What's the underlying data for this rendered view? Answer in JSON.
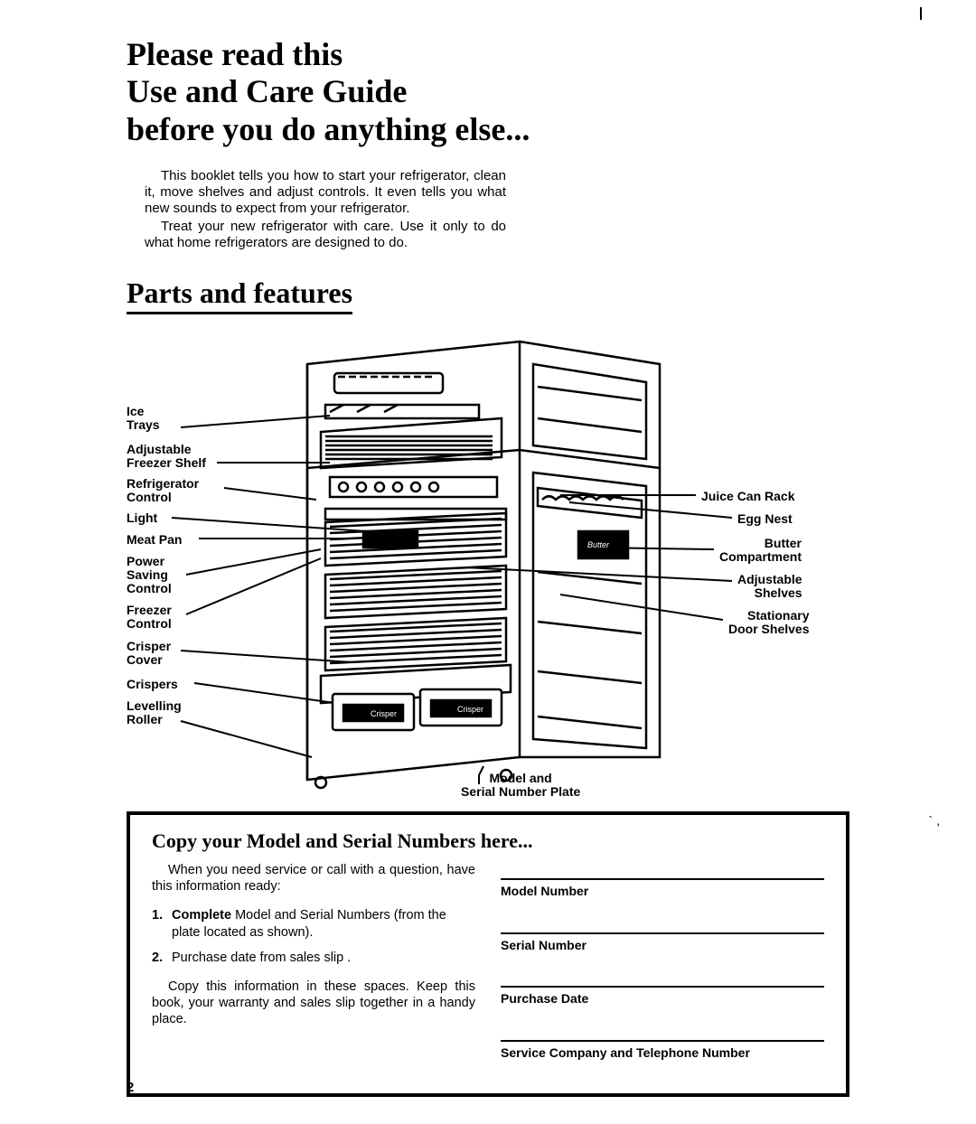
{
  "title_l1": "Please read this",
  "title_l2": "Use and Care Guide",
  "title_l3": "before you do anything else...",
  "intro_p1": "This booklet tells you how to start your refrigerator, clean it, move shelves and adjust controls. It even tells you what new sounds to expect from your refrigerator.",
  "intro_p2": "Treat your new refrigerator with care. Use it only to do what home refrigerators are designed to do.",
  "section_parts": "Parts and features",
  "labels_left": {
    "ice_trays": "Ice\nTrays",
    "adj_freezer_shelf": "Adjustable\nFreezer Shelf",
    "refrig_control": "Refrigerator\nControl",
    "light": "Light",
    "meat_pan": "Meat Pan",
    "power_saving": "Power\nSaving\nControl",
    "freezer_control": "Freezer\nControl",
    "crisper_cover": "Crisper\nCover",
    "crispers": "Crispers",
    "levelling_roller": "Levelling\nRoller"
  },
  "labels_right": {
    "juice_rack": "Juice Can Rack",
    "egg_nest": "Egg Nest",
    "butter": "Butter\nCompartment",
    "adj_shelves": "Adjustable\nShelves",
    "door_shelves": "Stationary\nDoor Shelves"
  },
  "label_bottom": "Model and\nSerial Number Plate",
  "crisper_text": "Crisper",
  "butter_text": "Butter",
  "info": {
    "title": "Copy your Model and Serial Numbers here...",
    "p_intro": "When you need service or call with a question, have this information ready:",
    "li1_bold": "Complete",
    "li1_rest": " Model and Serial Numbers (from the plate located as shown).",
    "li2": "Purchase date from sales slip .",
    "p_out": "Copy this information in these spaces. Keep this book, your warranty and sales slip together in a handy place.",
    "f_model": "Model Number",
    "f_serial": "Serial Number",
    "f_date": "Purchase Date",
    "f_service": "Service Company and Telephone Number"
  },
  "page_number": "2",
  "tick_right": "`  ,"
}
